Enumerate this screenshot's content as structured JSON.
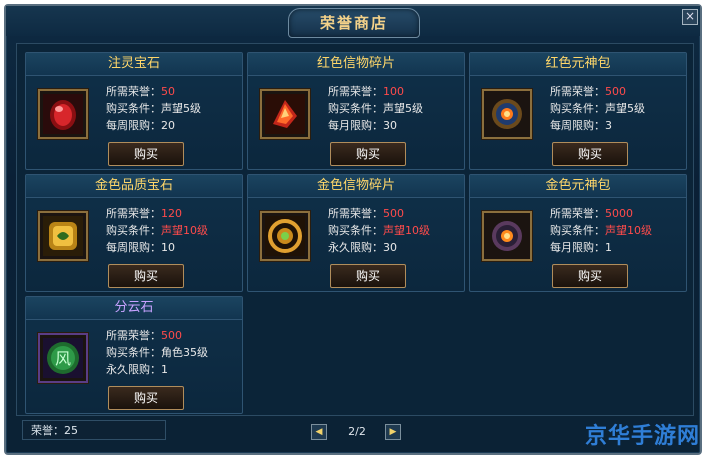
{
  "window": {
    "title": "荣誉商店",
    "close_glyph": "×"
  },
  "items": [
    {
      "name": "注灵宝石",
      "cost_label": "所需荣誉：",
      "cost": "50",
      "cond_label": "购买条件：",
      "cond": "声望5级",
      "limit_label": "每周限购：",
      "limit": "20",
      "buy": "购买",
      "icon": "red-gem-icon",
      "title_color": "gold"
    },
    {
      "name": "红色信物碎片",
      "cost_label": "所需荣誉：",
      "cost": "100",
      "cond_label": "购买条件：",
      "cond": "声望5级",
      "limit_label": "每月限购：",
      "limit": "30",
      "buy": "购买",
      "icon": "red-shard-icon",
      "title_color": "gold"
    },
    {
      "name": "红色元神包",
      "cost_label": "所需荣誉：",
      "cost": "500",
      "cond_label": "购买条件：",
      "cond": "声望5级",
      "limit_label": "每周限购：",
      "limit": "3",
      "buy": "购买",
      "icon": "red-spirit-pack-icon",
      "title_color": "gold"
    },
    {
      "name": "金色品质宝石",
      "cost_label": "所需荣誉：",
      "cost": "120",
      "cond_label": "购买条件：",
      "cond": "声望10级",
      "limit_label": "每周限购：",
      "limit": "10",
      "buy": "购买",
      "icon": "gold-gem-icon",
      "title_color": "gold"
    },
    {
      "name": "金色信物碎片",
      "cost_label": "所需荣誉：",
      "cost": "500",
      "cond_label": "购买条件：",
      "cond": "声望10级",
      "limit_label": "永久限购：",
      "limit": "30",
      "buy": "购买",
      "icon": "gold-shard-icon",
      "title_color": "gold"
    },
    {
      "name": "金色元神包",
      "cost_label": "所需荣誉：",
      "cost": "5000",
      "cond_label": "购买条件：",
      "cond": "声望10级",
      "limit_label": "每月限购：",
      "limit": "1",
      "buy": "购买",
      "icon": "gold-spirit-pack-icon",
      "title_color": "gold"
    },
    {
      "name": "分云石",
      "cost_label": "所需荣誉：",
      "cost": "500",
      "cond_label": "购买条件：",
      "cond": "角色35级",
      "limit_label": "永久限购：",
      "limit": "1",
      "buy": "购买",
      "icon": "wind-stone-icon",
      "icon_text": "风",
      "title_color": "purple"
    }
  ],
  "footer": {
    "honor_label": "荣誉：",
    "honor_value": "25",
    "page": "2/2",
    "prev": "◀",
    "next": "▶"
  },
  "watermark": "京华手游网",
  "colors": {
    "title_gold": "#ffd76a",
    "title_purple": "#c7a2ff",
    "value_red": "#ff4b4b",
    "window_bg": "#0e2a42",
    "button_border": "#b08d5c"
  }
}
